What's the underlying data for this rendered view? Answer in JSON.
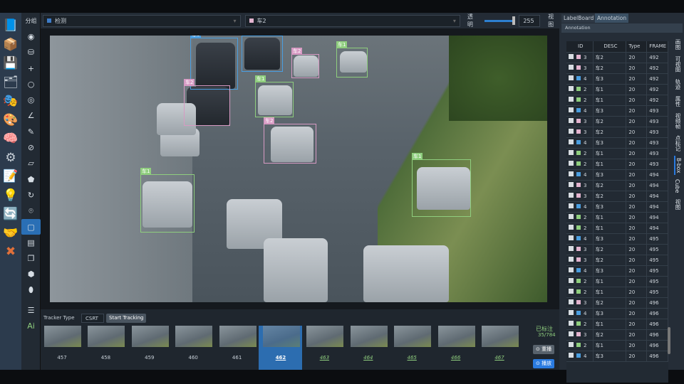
{
  "left_icons": [
    "book-icon",
    "package-icon",
    "save-icon",
    "save-as-icon",
    "mask-icon",
    "palette-icon",
    "ai-head-icon",
    "settings-icon",
    "edit-document-icon",
    "lightbulb-icon",
    "refresh-icon",
    "handshake-icon",
    "close-icon"
  ],
  "toolbar": {
    "group_label": "分组",
    "tools": [
      "eye-icon",
      "paint-bucket-icon",
      "crosshair-icon",
      "circle-icon",
      "circle-dotted-icon",
      "angle-icon",
      "brush-icon",
      "compass-icon",
      "eraser-icon",
      "polygon-fill-icon",
      "rotate-icon",
      "location-pin-icon",
      "rectangle-icon",
      "layers-icon",
      "cube-outline-icon",
      "cube-solid-icon",
      "blob-icon"
    ],
    "selected_tool": "rectangle-icon",
    "list_icon": "list-icon",
    "ai_label": "Ai"
  },
  "topbar": {
    "group_value": "检测",
    "group_color": "#3d7cc9",
    "label_value": "车2",
    "label_color": "#e3b4cf",
    "opacity_label": "透明",
    "opacity_value": "255",
    "opacity_fraction": 1.0,
    "view_label": "视图"
  },
  "annotations": [
    {
      "label": "车3",
      "color": "#4a9ee0"
    },
    {
      "label": "车3",
      "color": "#4a9ee0"
    },
    {
      "label": "车2",
      "color": "#d79ac3"
    },
    {
      "label": "车1",
      "color": "#8fce7e"
    },
    {
      "label": "车2",
      "color": "#d79ac3"
    },
    {
      "label": "车1",
      "color": "#8fce7e"
    },
    {
      "label": "车2",
      "color": "#d79ac3"
    },
    {
      "label": "车1",
      "color": "#8fce7e"
    },
    {
      "label": "车1",
      "color": "#8fce7e"
    }
  ],
  "tracker": {
    "type_label": "Tracker Type",
    "type_value": "CSRT",
    "start_label": "Start Tracking"
  },
  "frames": {
    "items": [
      "457",
      "458",
      "459",
      "460",
      "461",
      "462",
      "463",
      "464",
      "465",
      "466",
      "467"
    ],
    "selected": "462",
    "annotated_from": "463",
    "status_label": "已标注",
    "status_count": "35/784",
    "replay_label": "重播",
    "play_label": "播放"
  },
  "right": {
    "tabs": [
      "LabelBoard",
      "Annotation"
    ],
    "active_tab": "Annotation",
    "panel_title": "Annotation",
    "columns": [
      "ID",
      "DESC",
      "Type",
      "FRAME"
    ],
    "rows": [
      [
        "3",
        "车2",
        "20",
        "492"
      ],
      [
        "3",
        "车2",
        "20",
        "492"
      ],
      [
        "4",
        "车3",
        "20",
        "492"
      ],
      [
        "2",
        "车1",
        "20",
        "492"
      ],
      [
        "2",
        "车1",
        "20",
        "492"
      ],
      [
        "4",
        "车3",
        "20",
        "493"
      ],
      [
        "3",
        "车2",
        "20",
        "493"
      ],
      [
        "3",
        "车2",
        "20",
        "493"
      ],
      [
        "4",
        "车3",
        "20",
        "493"
      ],
      [
        "2",
        "车1",
        "20",
        "493"
      ],
      [
        "2",
        "车1",
        "20",
        "493"
      ],
      [
        "4",
        "车3",
        "20",
        "494"
      ],
      [
        "3",
        "车2",
        "20",
        "494"
      ],
      [
        "3",
        "车2",
        "20",
        "494"
      ],
      [
        "4",
        "车3",
        "20",
        "494"
      ],
      [
        "2",
        "车1",
        "20",
        "494"
      ],
      [
        "2",
        "车1",
        "20",
        "494"
      ],
      [
        "4",
        "车3",
        "20",
        "495"
      ],
      [
        "3",
        "车2",
        "20",
        "495"
      ],
      [
        "3",
        "车2",
        "20",
        "495"
      ],
      [
        "4",
        "车3",
        "20",
        "495"
      ],
      [
        "2",
        "车1",
        "20",
        "495"
      ],
      [
        "2",
        "车1",
        "20",
        "495"
      ],
      [
        "3",
        "车2",
        "20",
        "496"
      ],
      [
        "4",
        "车3",
        "20",
        "496"
      ],
      [
        "2",
        "车1",
        "20",
        "496"
      ],
      [
        "3",
        "车2",
        "20",
        "496"
      ],
      [
        "2",
        "车1",
        "20",
        "496"
      ],
      [
        "4",
        "车3",
        "20",
        "496"
      ]
    ],
    "id_colors": {
      "2": "#8fce7e",
      "3": "#e3b4cf",
      "4": "#4a9ee0"
    },
    "vertical_tabs": [
      "画图",
      "可视图",
      "轨迹",
      "属性",
      "视频帧",
      "点标记",
      "B-box",
      "Cube",
      "视图"
    ],
    "active_vertical_tab": "B-box"
  }
}
